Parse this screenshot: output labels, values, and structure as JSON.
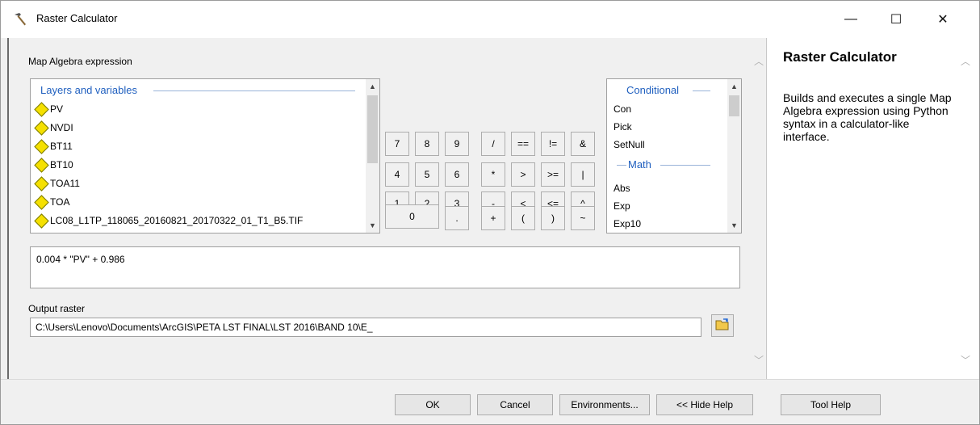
{
  "window": {
    "title": "Raster Calculator",
    "minimize": "—",
    "maximize": "☐",
    "close": "✕"
  },
  "main": {
    "expression_label": "Map Algebra expression",
    "layers_header": "Layers and variables",
    "layers": [
      "PV",
      "NVDI",
      "BT11",
      "BT10",
      "TOA11",
      "TOA",
      "LC08_L1TP_118065_20160821_20170322_01_T1_B5.TIF"
    ],
    "keypad": [
      [
        "7",
        "8",
        "9",
        "/",
        "==",
        "!=",
        "&"
      ],
      [
        "4",
        "5",
        "6",
        "*",
        ">",
        ">=",
        "|"
      ],
      [
        "1",
        "2",
        "3",
        "-",
        "<",
        "<=",
        "^"
      ],
      [
        "0",
        ".",
        "+",
        "(",
        ")",
        "~"
      ]
    ],
    "functions": {
      "group_conditional": "Conditional",
      "conditional": [
        "Con",
        "Pick",
        "SetNull"
      ],
      "group_math": "Math",
      "math": [
        "Abs",
        "Exp",
        "Exp10"
      ]
    },
    "expression": "0.004 * \"PV\" + 0.986",
    "output_label": "Output raster",
    "output_value": "C:\\Users\\Lenovo\\Documents\\ArcGIS\\PETA LST FINAL\\LST 2016\\BAND 10\\E_"
  },
  "help": {
    "title": "Raster Calculator",
    "description": "Builds and executes a single Map Algebra expression using Python syntax in a calculator-like interface."
  },
  "footer": {
    "ok": "OK",
    "cancel": "Cancel",
    "environments": "Environments...",
    "hide_help": "<< Hide Help",
    "tool_help": "Tool Help"
  },
  "colors": {
    "group_header": "#1f5fbf",
    "layer_diamond": "#f5e000"
  }
}
